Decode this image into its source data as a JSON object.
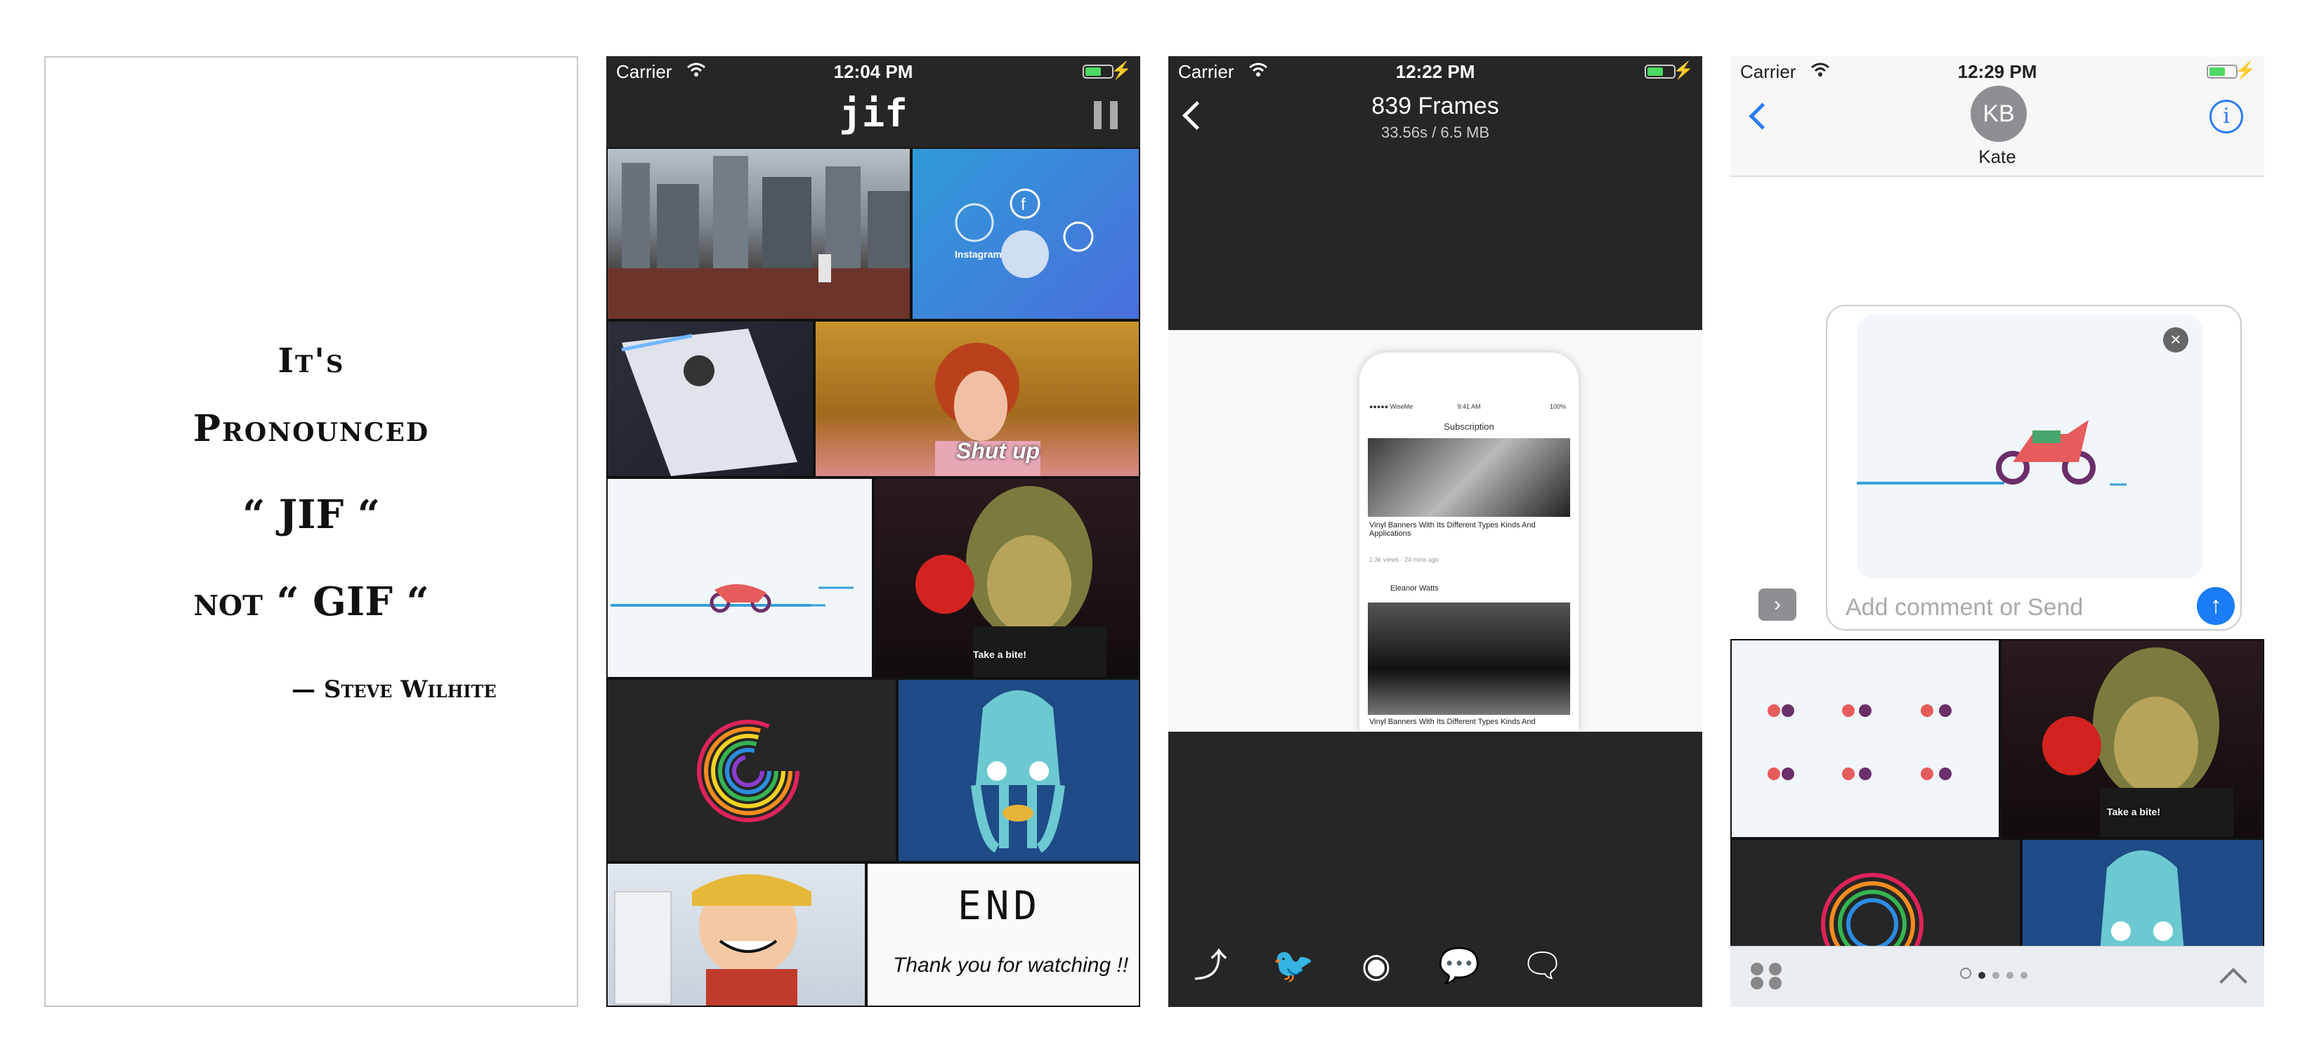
{
  "quote": {
    "line1": "It's",
    "line2": "Pronounced",
    "line3": "“ JIF “",
    "line4": "not “ GIF “",
    "author": "— Steve Wilhite"
  },
  "screen_feed": {
    "carrier": "Carrier",
    "time": "12:04 PM",
    "logo": "jif",
    "tiles": [
      {
        "caption": ""
      },
      {
        "caption": "Instagram"
      },
      {
        "caption": ""
      },
      {
        "caption": "Shut up"
      },
      {
        "caption": ""
      },
      {
        "caption": "Take a bite!"
      },
      {
        "caption": ""
      },
      {
        "caption": ""
      },
      {
        "caption": ""
      },
      {
        "caption": "END"
      },
      {
        "caption": "Thank you for watching !!"
      }
    ]
  },
  "screen_editor": {
    "carrier": "Carrier",
    "time": "12:22 PM",
    "title": "839 Frames",
    "subtitle": "33.56s / 6.5 MB",
    "phone": {
      "time": "9:41 AM",
      "battery": "100%",
      "carrier": "●●●●● WiseMe",
      "header": "Subscription",
      "article1": "Vinyl Banners With Its Different Types Kinds And Applications",
      "meta1": "1.3k views · 24 mins ago",
      "author": "Eleanor Watts",
      "article2": "Vinyl Banners With Its Different Types Kinds And"
    },
    "share_icons": [
      "share-icon",
      "twitter-icon",
      "weibo-icon",
      "wechat-icon",
      "chat-icon"
    ]
  },
  "screen_messages": {
    "carrier": "Carrier",
    "time": "12:29 PM",
    "avatar_initials": "KB",
    "contact": "Kate",
    "comment_placeholder": "Add comment or Send",
    "take_a_bite": "Take a bite!"
  },
  "colors": {
    "accent_blue": "#1a7cf6",
    "dark_bg": "#262626",
    "battery_green": "#4cd964"
  }
}
